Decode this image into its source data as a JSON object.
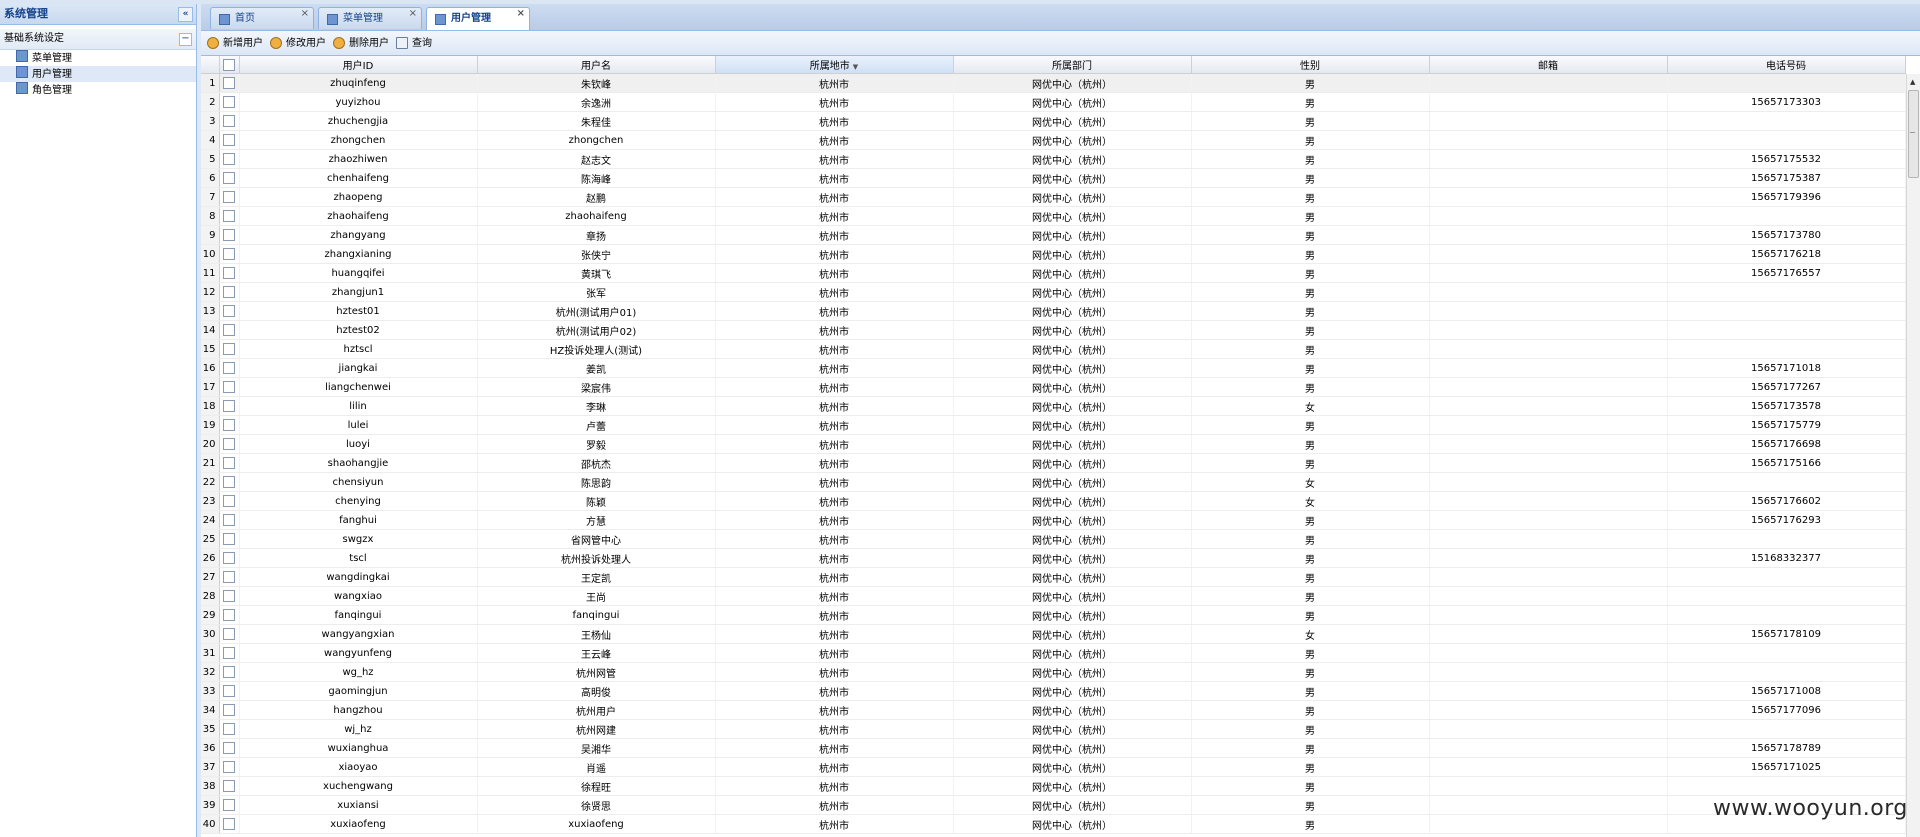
{
  "left_panel": {
    "title": "系统管理",
    "collapse_glyph": "«",
    "section": "基础系统设定",
    "section_btn": "−",
    "items": [
      {
        "label": "菜单管理",
        "selected": false
      },
      {
        "label": "用户管理",
        "selected": true
      },
      {
        "label": "角色管理",
        "selected": false
      }
    ]
  },
  "tabs": [
    {
      "label": "首页",
      "close": "×"
    },
    {
      "label": "菜单管理",
      "close": "×"
    },
    {
      "label": "用户管理",
      "close": "×"
    }
  ],
  "toolbar": {
    "add": "新增用户",
    "edit": "修改用户",
    "delete": "删除用户",
    "query": "查询"
  },
  "grid": {
    "columns": [
      "用户ID",
      "用户名",
      "所属地市",
      "所属部门",
      "性别",
      "邮箱",
      "电话号码"
    ],
    "sort_glyph": "▼",
    "rows": [
      [
        "1",
        "zhuqinfeng",
        "朱钦峰",
        "杭州市",
        "网优中心（杭州）",
        "男",
        "",
        ""
      ],
      [
        "2",
        "yuyizhou",
        "余逸洲",
        "杭州市",
        "网优中心（杭州）",
        "男",
        "",
        "15657173303"
      ],
      [
        "3",
        "zhuchengjia",
        "朱程佳",
        "杭州市",
        "网优中心（杭州）",
        "男",
        "",
        ""
      ],
      [
        "4",
        "zhongchen",
        "zhongchen",
        "杭州市",
        "网优中心（杭州）",
        "男",
        "",
        ""
      ],
      [
        "5",
        "zhaozhiwen",
        "赵志文",
        "杭州市",
        "网优中心（杭州）",
        "男",
        "",
        "15657175532"
      ],
      [
        "6",
        "chenhaifeng",
        "陈海峰",
        "杭州市",
        "网优中心（杭州）",
        "男",
        "",
        "15657175387"
      ],
      [
        "7",
        "zhaopeng",
        "赵鹏",
        "杭州市",
        "网优中心（杭州）",
        "男",
        "",
        "15657179396"
      ],
      [
        "8",
        "zhaohaifeng",
        "zhaohaifeng",
        "杭州市",
        "网优中心（杭州）",
        "男",
        "",
        ""
      ],
      [
        "9",
        "zhangyang",
        "章扬",
        "杭州市",
        "网优中心（杭州）",
        "男",
        "",
        "15657173780"
      ],
      [
        "10",
        "zhangxianing",
        "张侠宁",
        "杭州市",
        "网优中心（杭州）",
        "男",
        "",
        "15657176218"
      ],
      [
        "11",
        "huangqifei",
        "黄琪飞",
        "杭州市",
        "网优中心（杭州）",
        "男",
        "",
        "15657176557"
      ],
      [
        "12",
        "zhangjun1",
        "张军",
        "杭州市",
        "网优中心（杭州）",
        "男",
        "",
        ""
      ],
      [
        "13",
        "hztest01",
        "杭州(测试用户01)",
        "杭州市",
        "网优中心（杭州）",
        "男",
        "",
        ""
      ],
      [
        "14",
        "hztest02",
        "杭州(测试用户02)",
        "杭州市",
        "网优中心（杭州）",
        "男",
        "",
        ""
      ],
      [
        "15",
        "hztscl",
        "HZ投诉处理人(测试)",
        "杭州市",
        "网优中心（杭州）",
        "男",
        "",
        ""
      ],
      [
        "16",
        "jiangkai",
        "姜凯",
        "杭州市",
        "网优中心（杭州）",
        "男",
        "",
        "15657171018"
      ],
      [
        "17",
        "liangchenwei",
        "梁宸伟",
        "杭州市",
        "网优中心（杭州）",
        "男",
        "",
        "15657177267"
      ],
      [
        "18",
        "lilin",
        "李琳",
        "杭州市",
        "网优中心（杭州）",
        "女",
        "",
        "15657173578"
      ],
      [
        "19",
        "lulei",
        "卢蕾",
        "杭州市",
        "网优中心（杭州）",
        "男",
        "",
        "15657175779"
      ],
      [
        "20",
        "luoyi",
        "罗毅",
        "杭州市",
        "网优中心（杭州）",
        "男",
        "",
        "15657176698"
      ],
      [
        "21",
        "shaohangjie",
        "邵杭杰",
        "杭州市",
        "网优中心（杭州）",
        "男",
        "",
        "15657175166"
      ],
      [
        "22",
        "chensiyun",
        "陈思韵",
        "杭州市",
        "网优中心（杭州）",
        "女",
        "",
        ""
      ],
      [
        "23",
        "chenying",
        "陈颖",
        "杭州市",
        "网优中心（杭州）",
        "女",
        "",
        "15657176602"
      ],
      [
        "24",
        "fanghui",
        "方慧",
        "杭州市",
        "网优中心（杭州）",
        "男",
        "",
        "15657176293"
      ],
      [
        "25",
        "swgzx",
        "省网管中心",
        "杭州市",
        "网优中心（杭州）",
        "男",
        "",
        ""
      ],
      [
        "26",
        "tscl",
        "杭州投诉处理人",
        "杭州市",
        "网优中心（杭州）",
        "男",
        "",
        "15168332377"
      ],
      [
        "27",
        "wangdingkai",
        "王定凯",
        "杭州市",
        "网优中心（杭州）",
        "男",
        "",
        ""
      ],
      [
        "28",
        "wangxiao",
        "王尚",
        "杭州市",
        "网优中心（杭州）",
        "男",
        "",
        ""
      ],
      [
        "29",
        "fanqingui",
        "fanqingui",
        "杭州市",
        "网优中心（杭州）",
        "男",
        "",
        ""
      ],
      [
        "30",
        "wangyangxian",
        "王杨仙",
        "杭州市",
        "网优中心（杭州）",
        "女",
        "",
        "15657178109"
      ],
      [
        "31",
        "wangyunfeng",
        "王云峰",
        "杭州市",
        "网优中心（杭州）",
        "男",
        "",
        ""
      ],
      [
        "32",
        "wg_hz",
        "杭州网管",
        "杭州市",
        "网优中心（杭州）",
        "男",
        "",
        ""
      ],
      [
        "33",
        "gaomingjun",
        "高明俊",
        "杭州市",
        "网优中心（杭州）",
        "男",
        "",
        "15657171008"
      ],
      [
        "34",
        "hangzhou",
        "杭州用户",
        "杭州市",
        "网优中心（杭州）",
        "男",
        "",
        "15657177096"
      ],
      [
        "35",
        "wj_hz",
        "杭州网建",
        "杭州市",
        "网优中心（杭州）",
        "男",
        "",
        ""
      ],
      [
        "36",
        "wuxianghua",
        "吴湘华",
        "杭州市",
        "网优中心（杭州）",
        "男",
        "",
        "15657178789"
      ],
      [
        "37",
        "xiaoyao",
        "肖遥",
        "杭州市",
        "网优中心（杭州）",
        "男",
        "",
        "15657171025"
      ],
      [
        "38",
        "xuchengwang",
        "徐程旺",
        "杭州市",
        "网优中心（杭州）",
        "男",
        "",
        ""
      ],
      [
        "39",
        "xuxiansi",
        "徐贤思",
        "杭州市",
        "网优中心（杭州）",
        "男",
        "",
        ""
      ],
      [
        "40",
        "xuxiaofeng",
        "xuxiaofeng",
        "杭州市",
        "网优中心（杭州）",
        "男",
        "",
        ""
      ]
    ]
  },
  "scrollbar": {
    "up_glyph": "▲"
  },
  "watermark": "www.wooyun.org"
}
